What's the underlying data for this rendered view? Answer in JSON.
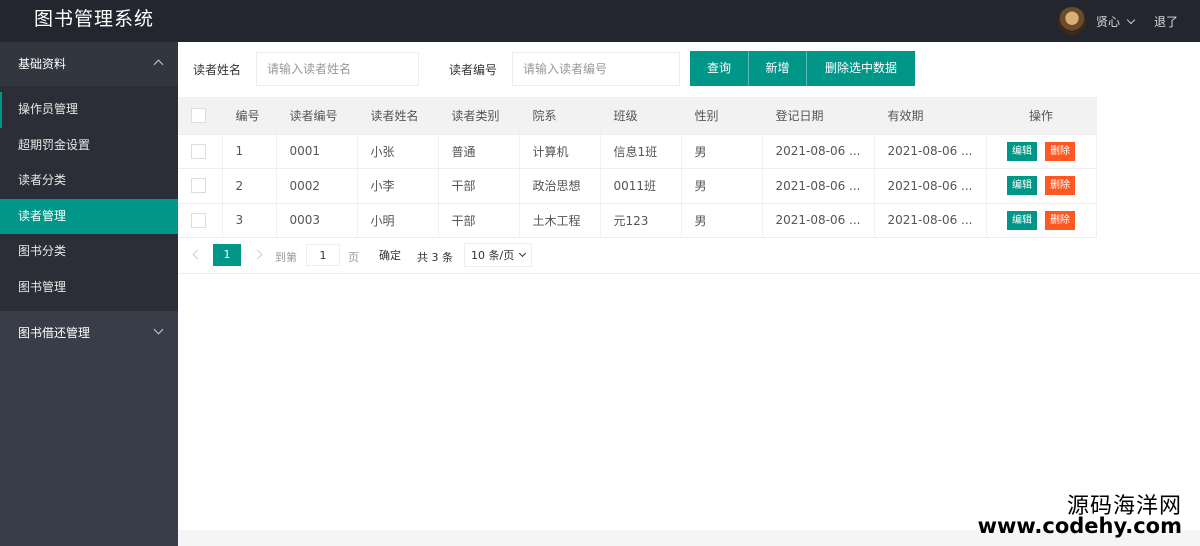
{
  "app": {
    "title": "图书管理系统",
    "user_name": "贤心",
    "logout_label": "退了"
  },
  "sidebar": {
    "groups": [
      {
        "label": "基础资料",
        "expanded": true,
        "items": [
          {
            "label": "操作员管理"
          },
          {
            "label": "超期罚金设置"
          },
          {
            "label": "读者分类"
          },
          {
            "label": "读者管理",
            "active": true
          },
          {
            "label": "图书分类"
          },
          {
            "label": "图书管理"
          }
        ]
      },
      {
        "label": "图书借还管理",
        "expanded": false
      }
    ]
  },
  "search": {
    "name_label": "读者姓名",
    "name_placeholder": "请输入读者姓名",
    "no_label": "读者编号",
    "no_placeholder": "请输入读者编号",
    "query_button": "查询",
    "add_button": "新增",
    "delete_selected_button": "删除选中数据"
  },
  "table": {
    "columns": [
      "编号",
      "读者编号",
      "读者姓名",
      "读者类别",
      "院系",
      "班级",
      "性别",
      "登记日期",
      "有效期",
      "操作"
    ],
    "rows": [
      {
        "id": "1",
        "reader_no": "0001",
        "name": "小张",
        "category": "普通",
        "dept": "计算机",
        "class": "信息1班",
        "gender": "男",
        "reg_date": "2021-08-06 ...",
        "valid": "2021-08-06 ..."
      },
      {
        "id": "2",
        "reader_no": "0002",
        "name": "小李",
        "category": "干部",
        "dept": "政治思想",
        "class": "0011班",
        "gender": "男",
        "reg_date": "2021-08-06 ...",
        "valid": "2021-08-06 ..."
      },
      {
        "id": "3",
        "reader_no": "0003",
        "name": "小明",
        "category": "干部",
        "dept": "土木工程",
        "class": "元123",
        "gender": "男",
        "reg_date": "2021-08-06 ...",
        "valid": "2021-08-06 ..."
      }
    ],
    "edit_label": "编辑",
    "delete_label": "删除"
  },
  "pager": {
    "current_page": "1",
    "goto_label": "到第",
    "goto_value": "1",
    "page_unit": "页",
    "confirm_label": "确定",
    "total_label": "共 3 条",
    "page_size_label": "10 条/页"
  },
  "watermark": {
    "line1": "源码海洋网",
    "line2": "www.codehy.com"
  },
  "colors": {
    "primary": "#009688",
    "danger": "#ff5722",
    "header_bg": "#23262e",
    "sidebar_bg": "#393d49"
  }
}
